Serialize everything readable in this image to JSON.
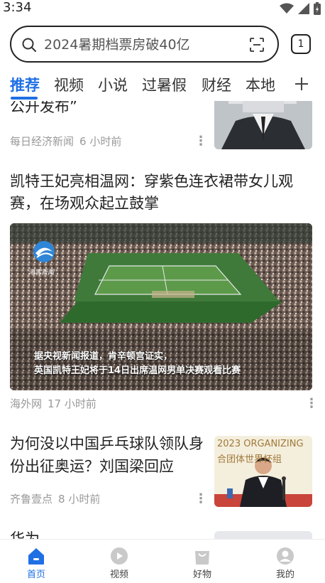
{
  "status": {
    "time": "3:34"
  },
  "search": {
    "query": "2024暑期档票房破40亿",
    "tab_count": "1"
  },
  "channels": [
    {
      "label": "推荐",
      "active": true
    },
    {
      "label": "视频",
      "active": false
    },
    {
      "label": "小说",
      "active": false
    },
    {
      "label": "过暑假",
      "active": false
    },
    {
      "label": "财经",
      "active": false
    },
    {
      "label": "本地",
      "active": false
    }
  ],
  "feed": {
    "articles": [
      {
        "title": "公开发布”",
        "source": "每日经济新闻",
        "time": "6 小时前",
        "thumbnail": "suited-figure-with-monitor-head"
      },
      {
        "title": "凯特王妃亮相温网：穿紫色连衣裙带女儿观赛，在场观众起立鼓掌",
        "source": "海外网",
        "time": "17 小时前",
        "video_logo": "海客新闻",
        "video_caption_1": "据央视新闻报道，肯辛顿宫证实，",
        "video_caption_2": "英国凯特王妃将于14日出席温网男单决赛观看比赛"
      },
      {
        "title": "为何没以中国乒乓球队领队身份出征奥运？刘国梁回应",
        "source": "齐鲁壹点",
        "time": "8 小时前",
        "thumb_text_1": "2023 ORGANIZING",
        "thumb_text_2": "合团体世界杯组"
      },
      {
        "title": "华为…",
        "source": "",
        "time": ""
      }
    ]
  },
  "bottom_nav": [
    {
      "label": "首页",
      "icon": "home-icon",
      "active": true
    },
    {
      "label": "视频",
      "icon": "video-play-icon",
      "active": false
    },
    {
      "label": "好物",
      "icon": "shopping-bag-icon",
      "active": false
    },
    {
      "label": "我的",
      "icon": "user-profile-icon",
      "active": false
    }
  ],
  "colors": {
    "accent": "#1f6fe5",
    "text": "#222222",
    "meta": "#999999"
  }
}
